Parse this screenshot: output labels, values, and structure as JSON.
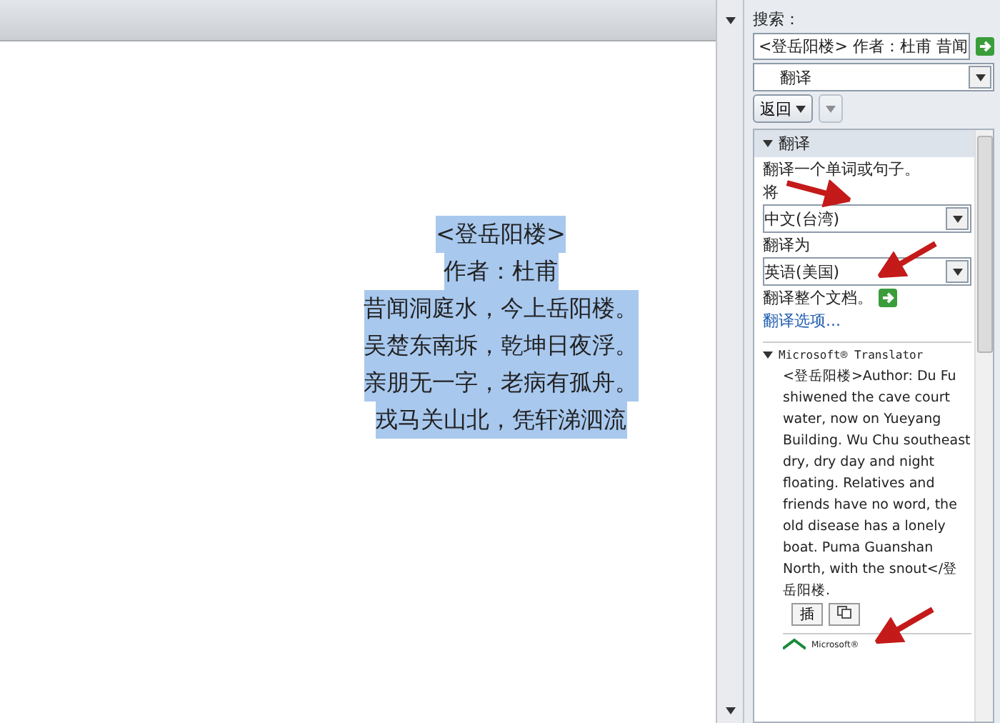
{
  "document": {
    "lines": [
      {
        "text": "<登岳阳楼>",
        "selected": true
      },
      {
        "text": "作者：杜甫",
        "selected": true
      },
      {
        "text": "昔闻洞庭水，今上岳阳楼。",
        "selected": true
      },
      {
        "text": "吴楚东南坼，乾坤日夜浮。",
        "selected": true
      },
      {
        "text": "亲朋无一字，老病有孤舟。",
        "selected": true
      },
      {
        "text": "戎马关山北，凭轩涕泗流",
        "selected": true
      }
    ]
  },
  "research_pane": {
    "search_label": "搜索：",
    "search_value": "<登岳阳楼> 作者：杜甫 昔闻",
    "service": "翻译",
    "back_button": "返回",
    "section_title": "翻译",
    "instruction": "翻译一个单词或句子。",
    "from_label": "将",
    "from_value": "中文(台湾)",
    "to_label": "翻译为",
    "to_value": "英语(美国)",
    "whole_document": "翻译整个文档。",
    "options_link": "翻译选项...",
    "translator_title": "Microsoft® Translator",
    "result": "<登岳阳楼>Author: Du Fu shiwened the cave court water, now on Yueyang Building. Wu Chu southeast dry, dry day and night floating. Relatives and friends have no word, the old disease has a lonely boat. Puma Guanshan North, with the snout</登岳阳楼.",
    "result_buttons": [
      "插"
    ],
    "logo_text": "Microsoft®"
  }
}
